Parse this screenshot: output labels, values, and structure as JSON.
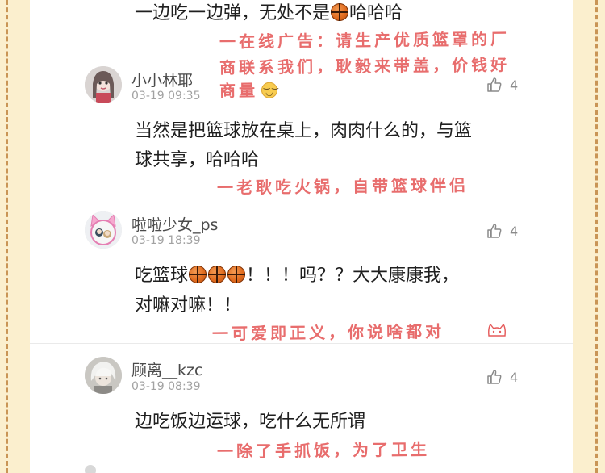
{
  "top_comment": {
    "body_before": "一边吃一边弹，无处不是",
    "body_after": "哈哈哈",
    "annotation_line1": "一在线广告：请生产优质篮罩的厂",
    "annotation_line2": "商联系我们，耿毅来带盖，价钱好",
    "annotation_line3": "商量"
  },
  "comments": [
    {
      "username": "小小林耶",
      "time": "03-19 09:35",
      "likes": "4",
      "avatar_icon": "girl-avatar-icon",
      "body_line1": "当然是把篮球放在桌上，肉肉什么的，与篮",
      "body_line2": "球共享，哈哈哈",
      "annotation": "一老耿吃火锅，自带篮球伴侣"
    },
    {
      "username": "啦啦少女_ps",
      "time": "03-19 18:39",
      "likes": "4",
      "avatar_icon": "cat-ears-avatar-icon",
      "body_prefix": "吃篮球",
      "body_suffix": "！！！吗？？大大康康我，",
      "body_line2": "对嘛对嘛！！",
      "annotation": "一可爱即正义，你说啥都对"
    },
    {
      "username": "顾离__kzc",
      "time": "03-19 08:39",
      "likes": "4",
      "avatar_icon": "white-hair-avatar-icon",
      "body_line1": "边吃饭边运球，吃什么无所谓",
      "annotation": "一除了手抓饭，为了卫生"
    }
  ],
  "colors": {
    "background": "#fbefce",
    "dashed_border": "#c99556",
    "annotation": "#e55a5a"
  }
}
